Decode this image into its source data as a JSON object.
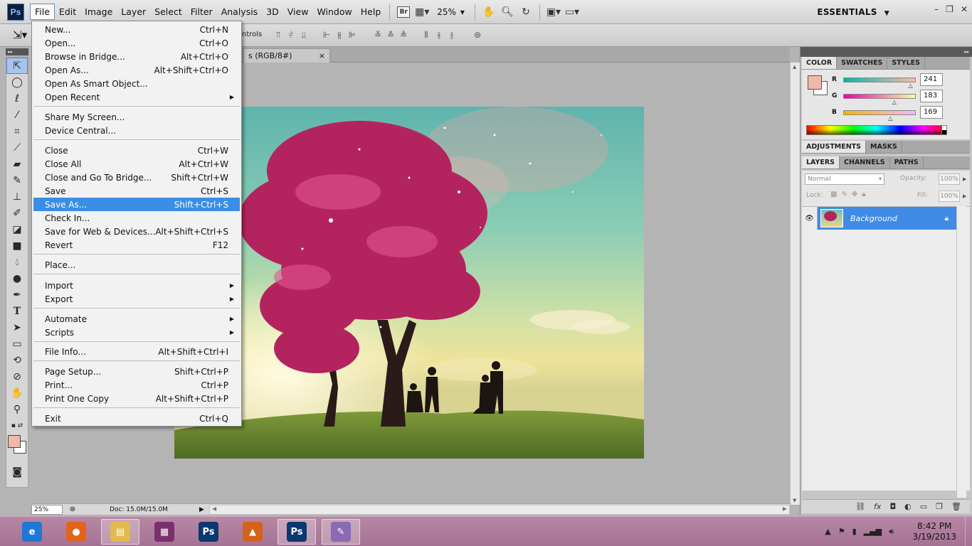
{
  "menubar": {
    "logo": "Ps",
    "items": [
      "File",
      "Edit",
      "Image",
      "Layer",
      "Select",
      "Filter",
      "Analysis",
      "3D",
      "View",
      "Window",
      "Help"
    ],
    "bridge_label": "Br",
    "zoom": "25%",
    "workspace": "ESSENTIALS",
    "window_controls": [
      "–",
      "❐",
      "✕"
    ]
  },
  "options_bar": {
    "controls_text": "ntrols"
  },
  "document": {
    "tab_title": "s (RGB/8#)",
    "tab_close": "×"
  },
  "statusbar": {
    "zoom": "25%",
    "doc_info": "Doc: 15.0M/15.0M"
  },
  "panels": {
    "color_tabs": [
      "COLOR",
      "SWATCHES",
      "STYLES"
    ],
    "color": {
      "r_label": "R",
      "g_label": "G",
      "b_label": "B",
      "r": "241",
      "g": "183",
      "b": "169",
      "r_fraction": 0.945,
      "g_fraction": 0.718,
      "b_fraction": 0.663,
      "foreground_hex": "#f1b7a9"
    },
    "adjust_tabs": [
      "ADJUSTMENTS",
      "MASKS"
    ],
    "layer_tabs": [
      "LAYERS",
      "CHANNELS",
      "PATHS"
    ],
    "layers": {
      "blend_mode": "Normal",
      "opacity_label": "Opacity:",
      "opacity": "100%",
      "lock_label": "Lock:",
      "fill_label": "Fill:",
      "fill": "100%",
      "items": [
        {
          "name": "Background"
        }
      ]
    }
  },
  "file_menu": {
    "items": [
      {
        "label": "New...",
        "shortcut": "Ctrl+N"
      },
      {
        "label": "Open...",
        "shortcut": "Ctrl+O"
      },
      {
        "label": "Browse in Bridge...",
        "shortcut": "Alt+Ctrl+O"
      },
      {
        "label": "Open As...",
        "shortcut": "Alt+Shift+Ctrl+O"
      },
      {
        "label": "Open As Smart Object...",
        "shortcut": ""
      },
      {
        "label": "Open Recent",
        "shortcut": ""
      },
      {
        "label": "Share My Screen...",
        "shortcut": ""
      },
      {
        "label": "Device Central...",
        "shortcut": ""
      },
      {
        "label": "Close",
        "shortcut": "Ctrl+W"
      },
      {
        "label": "Close All",
        "shortcut": "Alt+Ctrl+W"
      },
      {
        "label": "Close and Go To Bridge...",
        "shortcut": "Shift+Ctrl+W"
      },
      {
        "label": "Save",
        "shortcut": "Ctrl+S"
      },
      {
        "label": "Save As...",
        "shortcut": "Shift+Ctrl+S"
      },
      {
        "label": "Check In...",
        "shortcut": ""
      },
      {
        "label": "Save for Web & Devices...",
        "shortcut": "Alt+Shift+Ctrl+S"
      },
      {
        "label": "Revert",
        "shortcut": "F12"
      },
      {
        "label": "Place...",
        "shortcut": ""
      },
      {
        "label": "Import",
        "shortcut": ""
      },
      {
        "label": "Export",
        "shortcut": ""
      },
      {
        "label": "Automate",
        "shortcut": ""
      },
      {
        "label": "Scripts",
        "shortcut": ""
      },
      {
        "label": "File Info...",
        "shortcut": "Alt+Shift+Ctrl+I"
      },
      {
        "label": "Page Setup...",
        "shortcut": "Shift+Ctrl+P"
      },
      {
        "label": "Print...",
        "shortcut": "Ctrl+P"
      },
      {
        "label": "Print One Copy",
        "shortcut": "Alt+Shift+Ctrl+P"
      },
      {
        "label": "Exit",
        "shortcut": "Ctrl+Q"
      }
    ],
    "highlighted": "Save As..."
  },
  "taskbar": {
    "apps": [
      {
        "name": "internet-explorer-icon",
        "glyph": "e",
        "color": "#1e78d6"
      },
      {
        "name": "firefox-icon",
        "glyph": "●",
        "color": "#e5621c"
      },
      {
        "name": "file-explorer-icon",
        "glyph": "▤",
        "color": "#e2b94c"
      },
      {
        "name": "winrar-icon",
        "glyph": "▦",
        "color": "#7b2f6c"
      },
      {
        "name": "photoshop-icon",
        "glyph": "Ps",
        "color": "#0b3870"
      },
      {
        "name": "matlab-icon",
        "glyph": "▲",
        "color": "#d5611a"
      },
      {
        "name": "photoshop-active-icon",
        "glyph": "Ps",
        "color": "#0b3870"
      },
      {
        "name": "paint-icon",
        "glyph": "✎",
        "color": "#8a6ab2"
      }
    ],
    "time": "8:42 PM",
    "date": "3/19/2013"
  }
}
